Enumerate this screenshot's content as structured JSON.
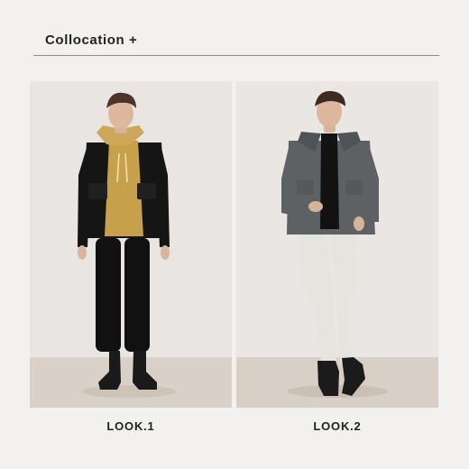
{
  "header": {
    "title": "Collocation +"
  },
  "looks": [
    {
      "label": "LOOK.1",
      "colors": {
        "background": "#e8e5e2",
        "floor": "#d9d1c7",
        "jacket": "#151515",
        "hoodie": "#c7a04b",
        "pants": "#111111",
        "boots": "#1a1a1a"
      }
    },
    {
      "label": "LOOK.2",
      "colors": {
        "background": "#e9e6e3",
        "floor": "#d8d0c6",
        "jacket": "#5e6164",
        "shirt": "#121212",
        "pants": "#e6e4de",
        "shoes": "#1b1b1b"
      }
    }
  ]
}
